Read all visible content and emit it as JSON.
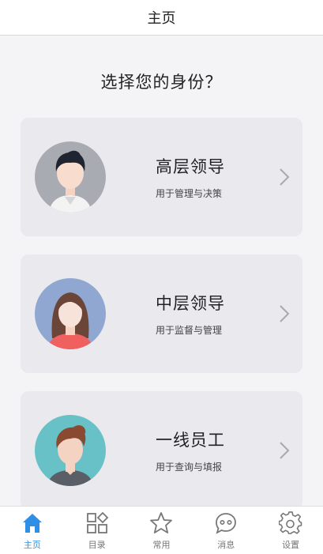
{
  "header": {
    "title": "主页"
  },
  "prompt": "选择您的身份？",
  "roles": [
    {
      "title": "高层领导",
      "desc": "用于管理与决策",
      "avatar_icon": "male-executive-avatar"
    },
    {
      "title": "中层领导",
      "desc": "用于监督与管理",
      "avatar_icon": "female-manager-avatar"
    },
    {
      "title": "一线员工",
      "desc": "用于查询与填报",
      "avatar_icon": "male-staff-avatar"
    }
  ],
  "tabs": [
    {
      "label": "主页",
      "icon": "home-icon",
      "active": true
    },
    {
      "label": "目录",
      "icon": "grid-icon"
    },
    {
      "label": "常用",
      "icon": "star-icon"
    },
    {
      "label": "消息",
      "icon": "chat-icon"
    },
    {
      "label": "设置",
      "icon": "gear-icon"
    }
  ],
  "colors": {
    "accent": "#2f8fe6",
    "card": "#e9e9ee",
    "background": "#f4f4f6"
  }
}
